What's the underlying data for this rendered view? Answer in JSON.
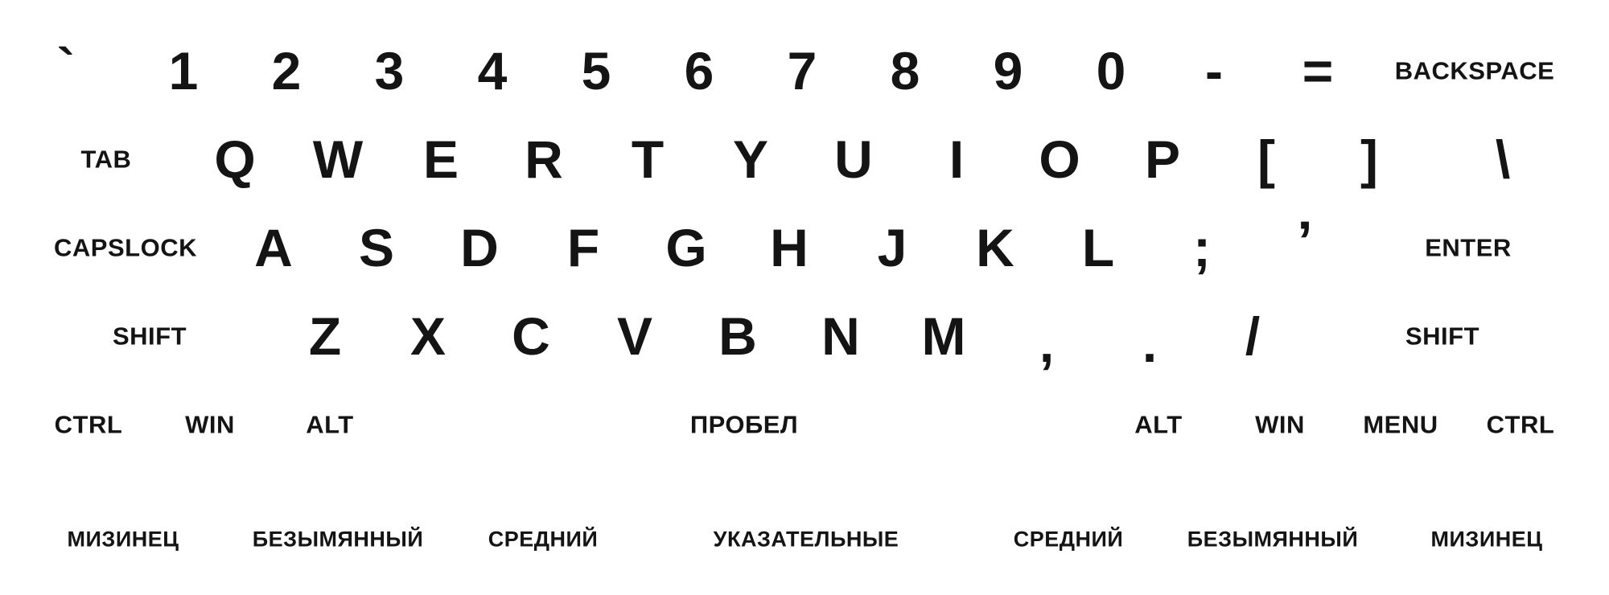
{
  "rows": {
    "number": [
      "`",
      "1",
      "2",
      "3",
      "4",
      "5",
      "6",
      "7",
      "8",
      "9",
      "0",
      "-",
      "="
    ],
    "number_backspace": "BACKSPACE",
    "top_tab": "TAB",
    "top": [
      "Q",
      "W",
      "E",
      "R",
      "T",
      "Y",
      "U",
      "I",
      "O",
      "P",
      "[",
      "]",
      "\\"
    ],
    "home_caps": "CAPSLOCK",
    "home": [
      "A",
      "S",
      "D",
      "F",
      "G",
      "H",
      "J",
      "K",
      "L",
      ";",
      "’"
    ],
    "home_enter": "ENTER",
    "bottom_shift_left": "SHIFT",
    "bottom": [
      "Z",
      "X",
      "C",
      "V",
      "B",
      "N",
      "M",
      ",",
      ".",
      "/"
    ],
    "bottom_shift_right": "SHIFT",
    "modifiers": {
      "ctrl_left": "CTRL",
      "win_left": "WIN",
      "alt_left": "ALT",
      "space": "ПРОБЕЛ",
      "alt_right": "ALT",
      "win_right": "WIN",
      "menu": "MENU",
      "ctrl_right": "CTRL"
    }
  },
  "fingers": [
    "МИЗИНЕЦ",
    "БЕЗЫМЯННЫЙ",
    "СРЕДНИЙ",
    "УКАЗАТЕЛЬНЫЕ",
    "СРЕДНИЙ",
    "БЕЗЫМЯННЫЙ",
    "МИЗИНЕЦ"
  ]
}
